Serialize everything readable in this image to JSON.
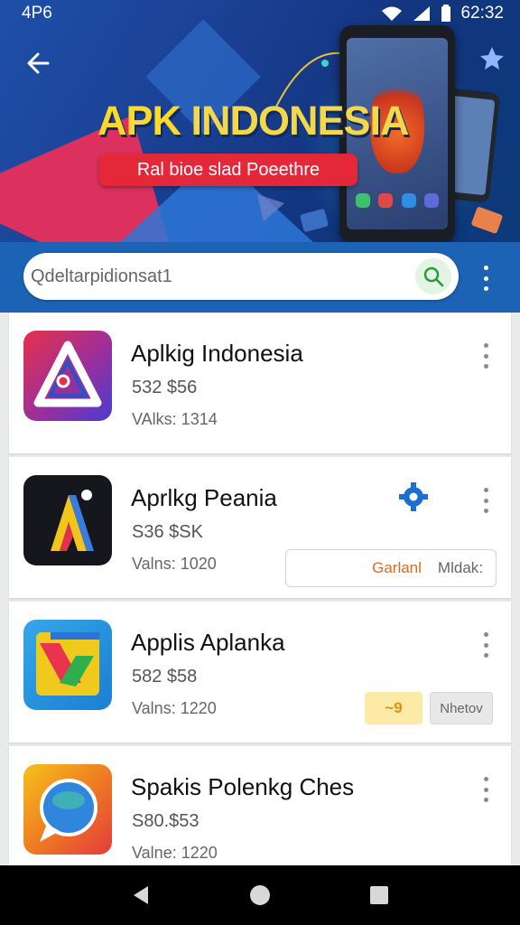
{
  "status_bar": {
    "time_left": "4P6",
    "time_right": "62:32"
  },
  "hero": {
    "title_part1": "APK",
    "title_part2": "INDONESIA",
    "subtitle": "Ral bioe slad Poeethre"
  },
  "search": {
    "query": "Qdeltarpidionsat1"
  },
  "apps": [
    {
      "name": "Aplkig Indonesia",
      "price": "532 $56",
      "meta": "VAlks: 1314"
    },
    {
      "name": "Aprlkg Peania",
      "price": "S36 $SK",
      "meta": "Valns: 1020",
      "action_primary": "Garlanl",
      "action_secondary": "Mldak:"
    },
    {
      "name": "Applis Aplanka",
      "price": "582 $58",
      "meta": "Valns: 1220",
      "action_yellow": "~9",
      "action_gray": "Nhetov"
    },
    {
      "name": "Spakis Polenkg Ches",
      "price": "S80.$53",
      "meta": "Valne: 1220"
    }
  ],
  "colors": {
    "header_blue": "#1c63b5",
    "title_yellow": "#ffd92a",
    "subtitle_red": "#e4283a",
    "accent_orange": "#e06a1c"
  },
  "icons": [
    "back-arrow-icon",
    "search-icon",
    "more-vertical-icon",
    "gear-icon",
    "wifi-icon",
    "signal-icon",
    "battery-icon",
    "nav-back-icon",
    "nav-home-icon",
    "nav-recents-icon"
  ]
}
